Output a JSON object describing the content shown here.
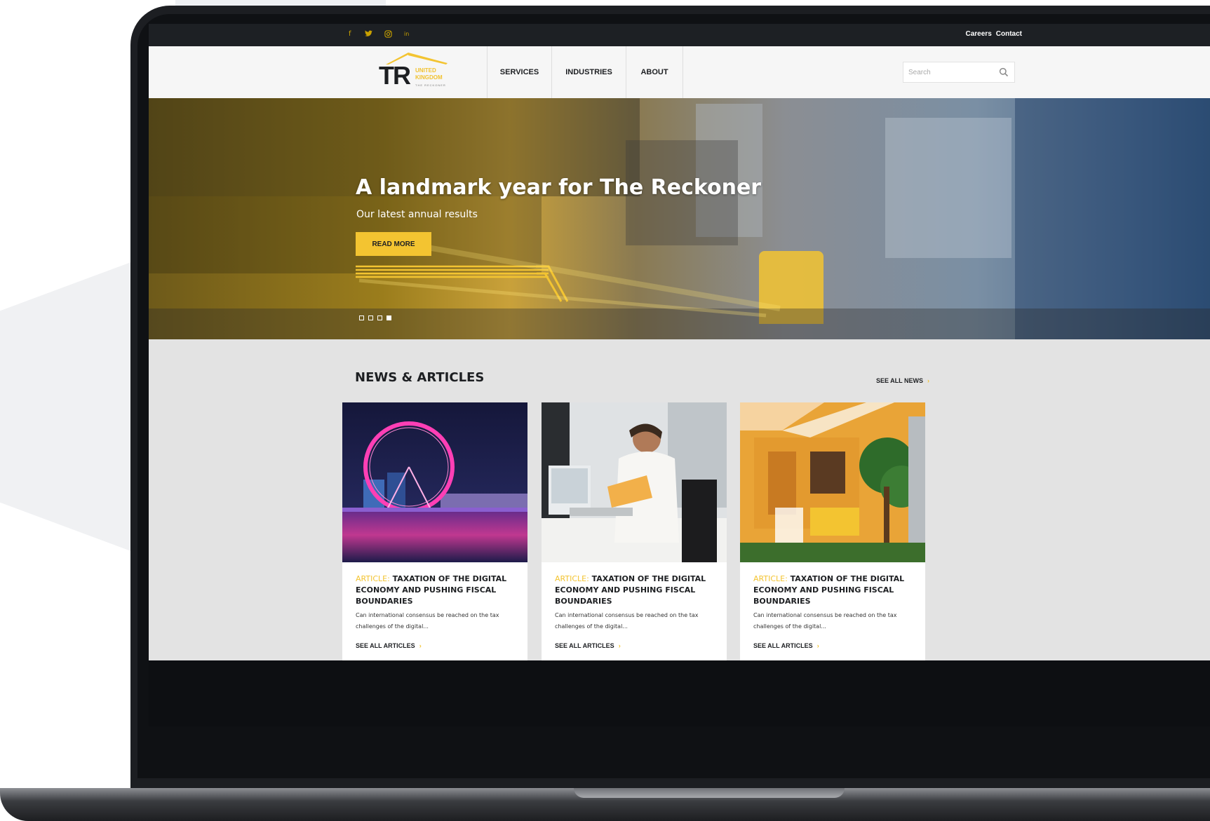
{
  "topbar": {
    "social": [
      {
        "icon": "facebook-icon",
        "glyph": "f"
      },
      {
        "icon": "twitter-icon",
        "glyph": "🐦"
      },
      {
        "icon": "instagram-icon",
        "glyph": "◎"
      },
      {
        "icon": "linkedin-icon",
        "glyph": "in"
      }
    ],
    "links": [
      "Careers",
      "Contact"
    ]
  },
  "logo": {
    "letters": "TR",
    "region": "UNITED KINGDOM",
    "tagline": "THE RECKONER"
  },
  "nav": {
    "items": [
      "SERVICES",
      "INDUSTRIES",
      "ABOUT"
    ]
  },
  "search": {
    "placeholder": "Search"
  },
  "hero": {
    "title": "A landmark year for The Reckoner",
    "subtitle": "Our latest annual results",
    "button": "READ MORE",
    "slides_total": 4,
    "slide_active": 4
  },
  "news": {
    "heading": "NEWS & ARTICLES",
    "see_all": "SEE ALL NEWS",
    "cards": [
      {
        "kind": "ARTICLE:",
        "title": "TAXATION OF THE DIGITAL ECONOMY AND PUSHING FISCAL BOUNDARIES",
        "excerpt": "Can international consensus be reached on the tax challenges of the digital...",
        "link": "SEE ALL ARTICLES"
      },
      {
        "kind": "ARTICLE:",
        "title": "TAXATION OF THE DIGITAL ECONOMY AND PUSHING FISCAL BOUNDARIES",
        "excerpt": "Can international consensus be reached on the tax challenges of the digital...",
        "link": "SEE ALL ARTICLES"
      },
      {
        "kind": "ARTICLE:",
        "title": "TAXATION OF THE DIGITAL ECONOMY AND PUSHING FISCAL BOUNDARIES",
        "excerpt": "Can international consensus be reached on the tax challenges of the digital...",
        "link": "SEE ALL ARTICLES"
      }
    ]
  },
  "colors": {
    "accent": "#f3c431",
    "dark": "#1d1f22",
    "topbar": "#1d2024",
    "news_bg": "#e3e3e3"
  }
}
